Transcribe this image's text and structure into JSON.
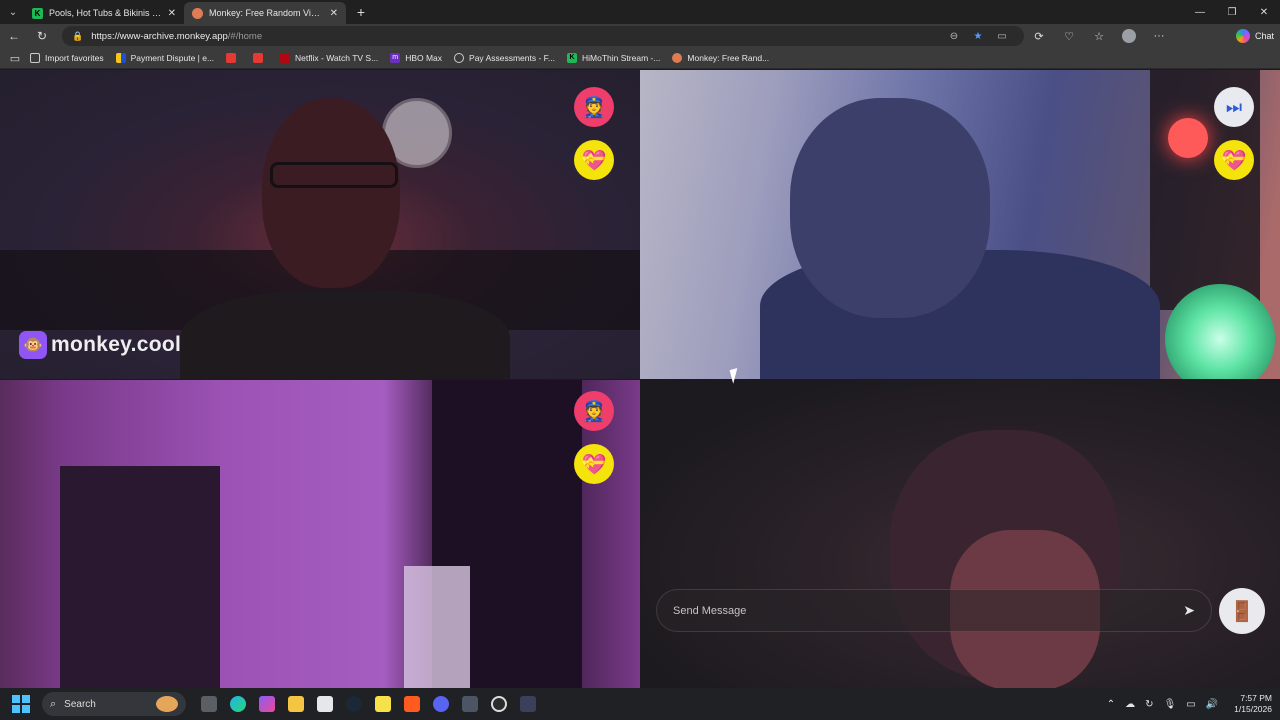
{
  "browser": {
    "tabs": [
      {
        "title": "Pools, Hot Tubs & Bikinis Stream",
        "favicon": "kick-icon",
        "active": false
      },
      {
        "title": "Monkey: Free Random Video Chat",
        "favicon": "monkey-icon",
        "active": true
      }
    ],
    "url_host": "https://www-archive.monkey.app",
    "url_path": "/#/home",
    "chat_label": "Chat"
  },
  "favorites": [
    {
      "label": "Import favorites",
      "icon": "import"
    },
    {
      "label": "Payment Dispute | e...",
      "icon": "flag"
    },
    {
      "label": "",
      "icon": "yt"
    },
    {
      "label": "",
      "icon": "yt"
    },
    {
      "label": "Netflix - Watch TV S...",
      "icon": "netflix"
    },
    {
      "label": "HBO Max",
      "icon": "hbo"
    },
    {
      "label": "Pay Assessments - F...",
      "icon": "globe"
    },
    {
      "label": "HiMoThin Stream -...",
      "icon": "k"
    },
    {
      "label": "Monkey: Free Rand...",
      "icon": "monkey"
    }
  ],
  "app": {
    "watermark": "monkey.cool",
    "message_placeholder": "Send Message",
    "reactions": [
      "police-officer-icon",
      "heart-gift-icon"
    ],
    "colors": {
      "police": "#ef3e6b",
      "heart": "#f5e30c",
      "brand": "#8f55f5"
    }
  },
  "taskbar": {
    "search_label": "Search",
    "time": "7:57 PM",
    "date": "1/15/2026"
  }
}
